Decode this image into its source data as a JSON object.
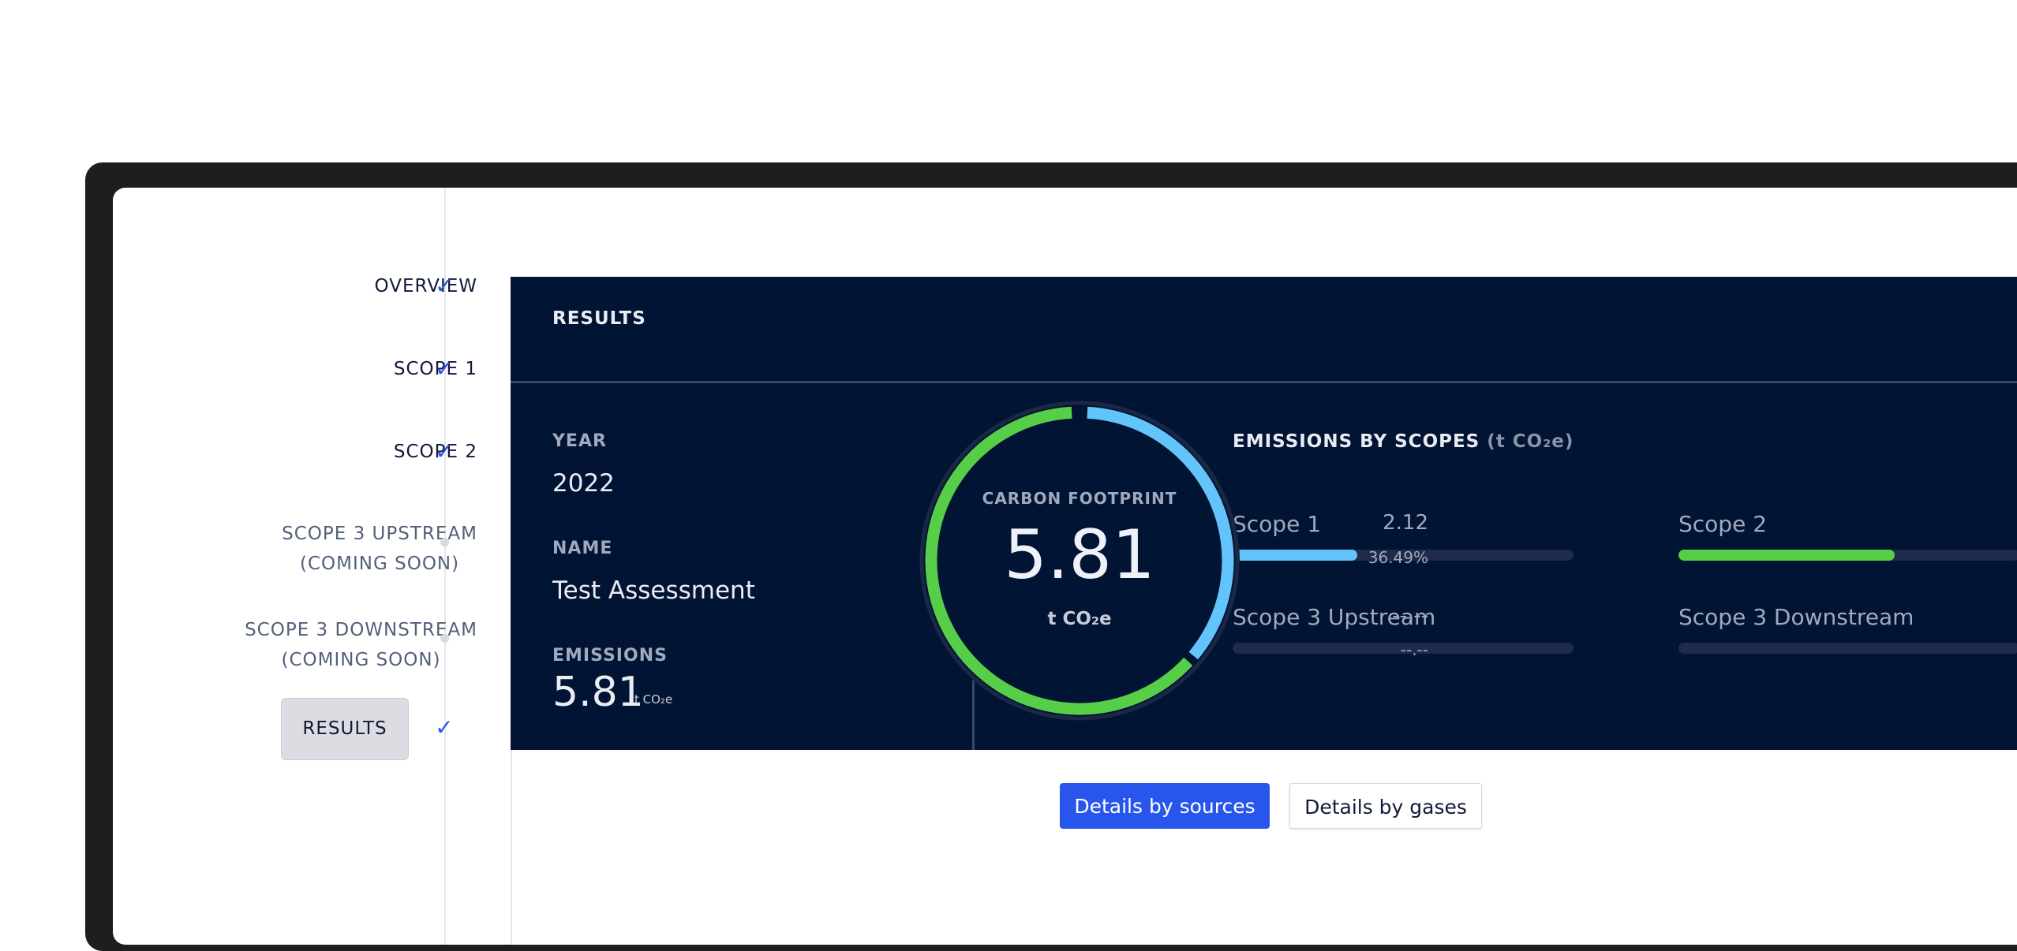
{
  "stepper": {
    "items": [
      {
        "label": "OVERVIEW",
        "status": "check-icon"
      },
      {
        "label": "SCOPE 1",
        "status": "check-icon"
      },
      {
        "label": "SCOPE 2",
        "status": "check-icon"
      },
      {
        "label": "SCOPE 3 UPSTREAM",
        "sublabel": "(COMING SOON)",
        "status": "dot"
      },
      {
        "label": "SCOPE 3 DOWNSTREAM",
        "sublabel": "(COMING SOON)",
        "status": "dot"
      },
      {
        "label": "RESULTS",
        "status": "check-icon"
      }
    ],
    "check_glyph": "✓"
  },
  "results": {
    "title": "RESULTS",
    "year_label": "YEAR",
    "year_value": "2022",
    "name_label": "NAME",
    "name_value": "Test Assessment",
    "emissions_label": "EMISSIONS",
    "emissions_value": "5.81",
    "emissions_unit": "t CO₂e"
  },
  "footprint": {
    "label": "CARBON FOOTPRINT",
    "value": "5.81",
    "unit": "t CO₂e",
    "scope1_fraction": 0.3649,
    "scope2_fraction": 0.6351
  },
  "emissions_by_scopes": {
    "title": "EMISSIONS BY SCOPES",
    "unit": "(t CO₂e)",
    "scopes": [
      {
        "name": "Scope 1",
        "value": "2.12",
        "percent": "36.49%",
        "fill": 0.3649,
        "color": "#62c4fa"
      },
      {
        "name": "Scope 2",
        "value": "",
        "percent": "",
        "fill": 0.6351,
        "color": "#57ce47"
      },
      {
        "name": "Scope 3 Upstream",
        "value": "--.--",
        "percent": "--.--",
        "fill": 0,
        "color": "#62c4fa"
      },
      {
        "name": "Scope 3 Downstream",
        "value": "",
        "percent": "",
        "fill": 0,
        "color": "#57ce47"
      }
    ]
  },
  "buttons": {
    "sources_label": "Details by sources",
    "gases_label": "Details by gases"
  },
  "colors": {
    "panel": "#021433",
    "accent": "#2856ec",
    "scope1": "#62c4fa",
    "scope2": "#57ce47"
  }
}
